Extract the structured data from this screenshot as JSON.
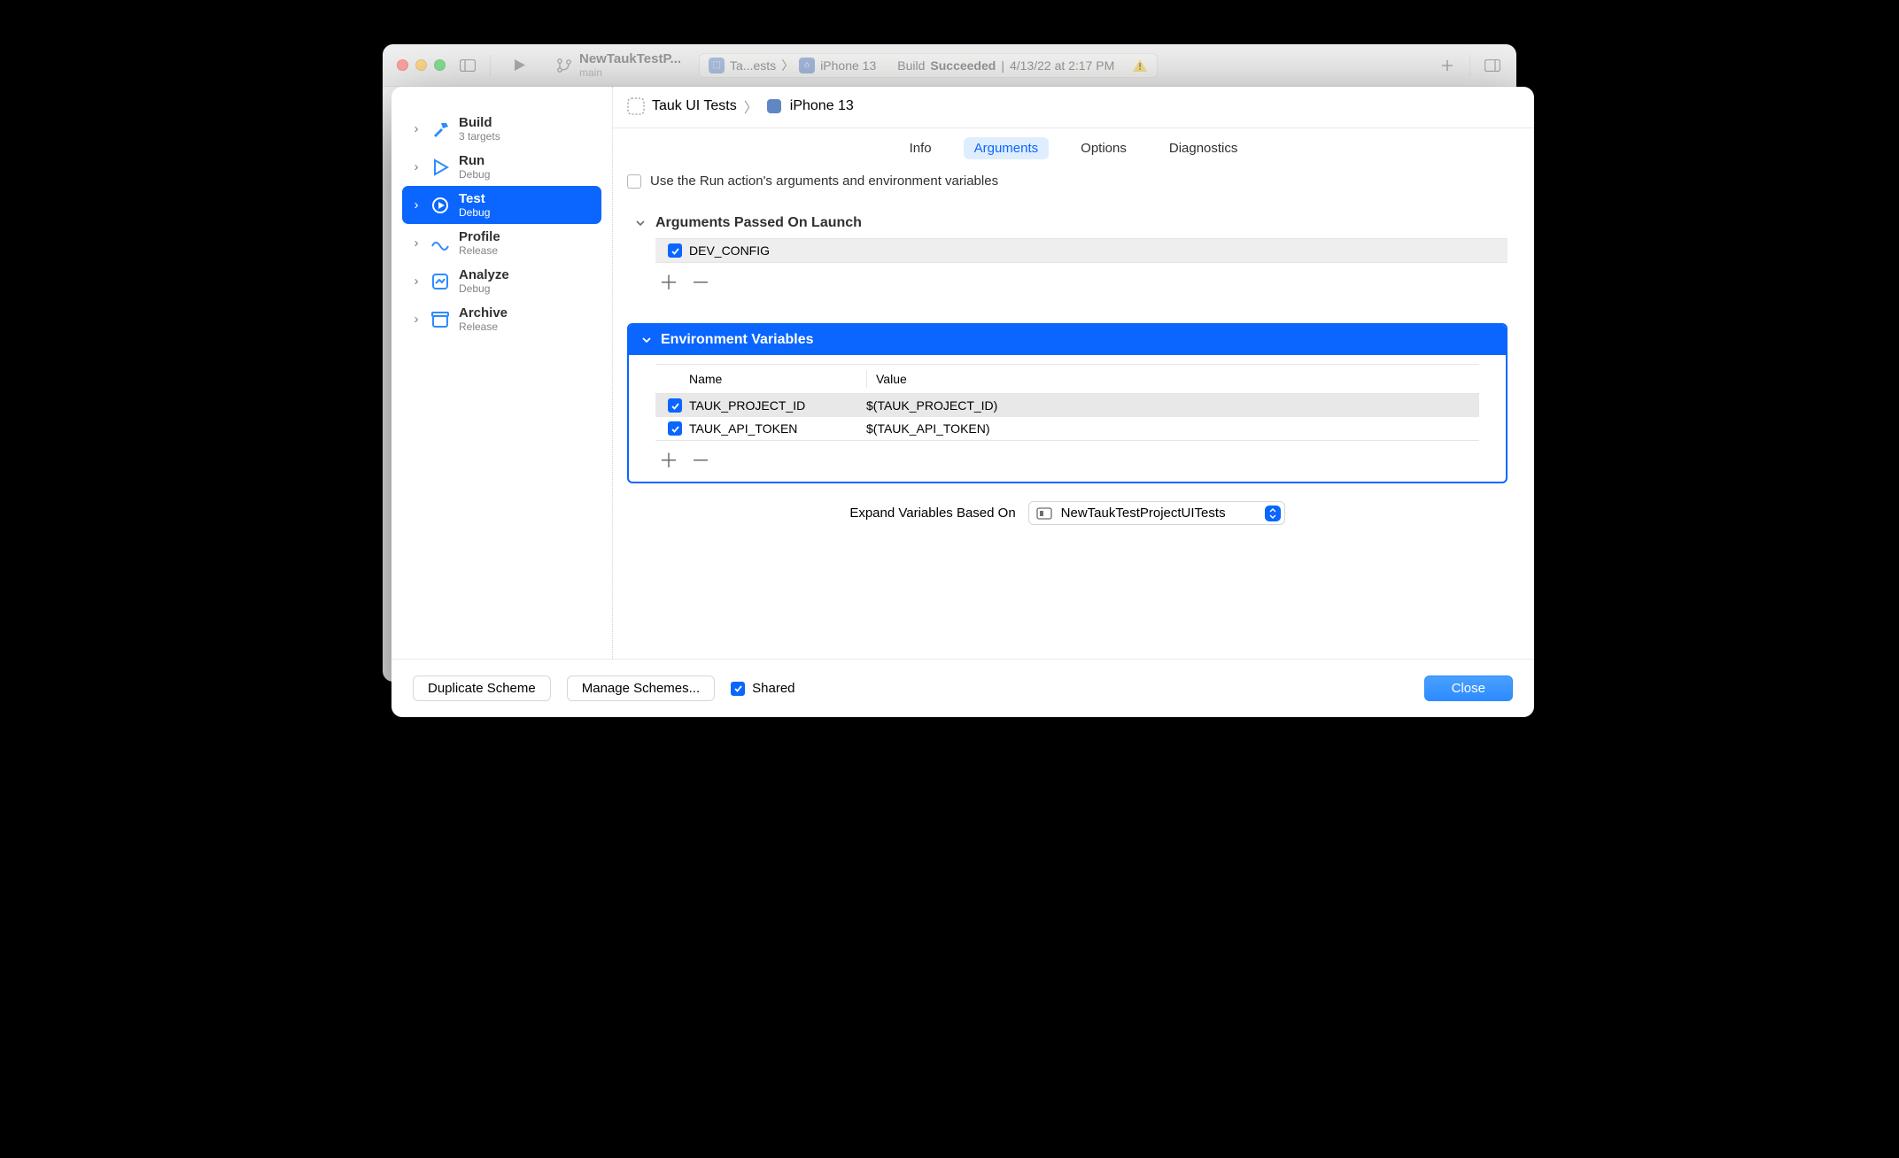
{
  "title": {
    "project_name": "NewTaukTestP...",
    "branch": "main",
    "scheme_crumb_left": "Ta...ests",
    "scheme_crumb_device": "iPhone 13",
    "build_status_label": "Build",
    "build_status_value": "Succeeded",
    "build_time": "4/13/22 at 2:17 PM"
  },
  "sidebar": {
    "items": [
      {
        "label": "Build",
        "sub": "3 targets"
      },
      {
        "label": "Run",
        "sub": "Debug"
      },
      {
        "label": "Test",
        "sub": "Debug"
      },
      {
        "label": "Profile",
        "sub": "Release"
      },
      {
        "label": "Analyze",
        "sub": "Debug"
      },
      {
        "label": "Archive",
        "sub": "Release"
      }
    ]
  },
  "main": {
    "crumb_scheme": "Tauk UI Tests",
    "crumb_device": "iPhone 13",
    "tabs": {
      "info": "Info",
      "arguments": "Arguments",
      "options": "Options",
      "diagnostics": "Diagnostics"
    },
    "use_run_args_label": "Use the Run action's arguments and environment variables",
    "args_section_label": "Arguments Passed On Launch",
    "arguments": [
      {
        "enabled": true,
        "value": "DEV_CONFIG"
      }
    ],
    "env_section_label": "Environment Variables",
    "env_header_name": "Name",
    "env_header_value": "Value",
    "env_vars": [
      {
        "enabled": true,
        "name": "TAUK_PROJECT_ID",
        "value": "$(TAUK_PROJECT_ID)"
      },
      {
        "enabled": true,
        "name": "TAUK_API_TOKEN",
        "value": "$(TAUK_API_TOKEN)"
      }
    ],
    "expand_label": "Expand Variables Based On",
    "expand_target": "NewTaukTestProjectUITests"
  },
  "footer": {
    "duplicate": "Duplicate Scheme",
    "manage": "Manage Schemes...",
    "shared": "Shared",
    "close": "Close"
  }
}
